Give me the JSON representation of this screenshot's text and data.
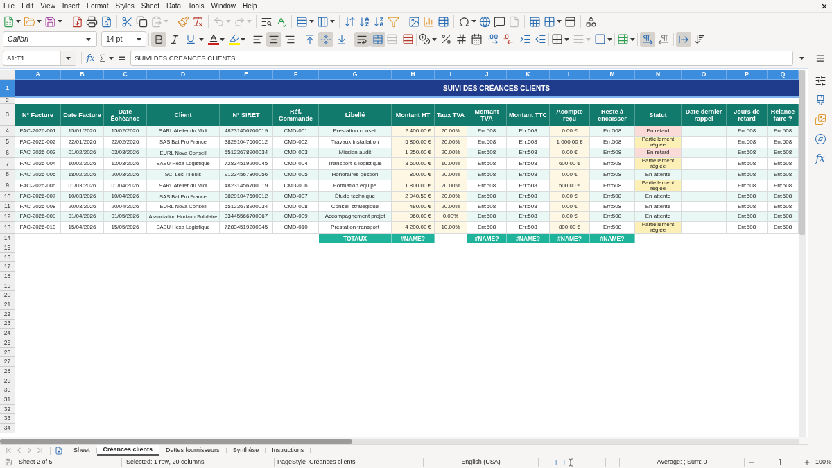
{
  "menu_bar": {
    "items": [
      "File",
      "Edit",
      "View",
      "Insert",
      "Format",
      "Styles",
      "Sheet",
      "Data",
      "Tools",
      "Window",
      "Help"
    ]
  },
  "standard_toolbar": {
    "paste": {
      "disabled": true
    },
    "undo": {
      "disabled": true
    },
    "redo": {
      "disabled": true
    },
    "header_footer": {
      "disabled": true
    }
  },
  "formatting_toolbar": {
    "font_name": "Calibri",
    "font_size": "14 pt",
    "bold": {
      "pressed": true
    },
    "italic": {
      "pressed": false
    },
    "underline": {
      "pressed": false
    },
    "align_left": {
      "pressed": false
    },
    "align_center": {
      "pressed": true
    },
    "align_right": {
      "pressed": false
    },
    "align_top": {
      "pressed": false
    },
    "align_middle": {
      "pressed": true
    },
    "align_bottom": {
      "pressed": false
    },
    "wrap_text": {
      "pressed": true
    },
    "merge_cells": {
      "pressed": true
    },
    "unmerge_cells": {
      "disabled": true
    },
    "border_style": {
      "disabled": true
    },
    "left_to_right": {
      "pressed": true
    },
    "right_to_left": {
      "pressed": false
    },
    "text_horizontal": {
      "pressed": true
    },
    "text_vertical": {
      "pressed": false
    }
  },
  "formula_bar": {
    "name_box": "A1:T1",
    "function_wizard": "fx",
    "formula": "SUIVI DES CRÉANCES CLIENTS"
  },
  "sheet": {
    "column_headers": [
      {
        "label": "A",
        "selected": true
      },
      {
        "label": "B",
        "selected": true
      },
      {
        "label": "C",
        "selected": true
      },
      {
        "label": "D",
        "selected": true
      },
      {
        "label": "E",
        "selected": true
      },
      {
        "label": "F",
        "selected": true
      },
      {
        "label": "G",
        "selected": true
      },
      {
        "label": "H",
        "selected": true
      },
      {
        "label": "I",
        "selected": true
      },
      {
        "label": "J",
        "selected": true
      },
      {
        "label": "K",
        "selected": true
      },
      {
        "label": "L",
        "selected": true
      },
      {
        "label": "M",
        "selected": true
      },
      {
        "label": "N",
        "selected": true
      },
      {
        "label": "O",
        "selected": true
      },
      {
        "label": "P",
        "selected": true
      },
      {
        "label": "Q",
        "selected": true
      }
    ],
    "row_headers": [
      {
        "label": "1",
        "selected": true
      },
      {
        "label": "2",
        "selected": false
      },
      {
        "label": "3",
        "selected": false
      },
      {
        "label": "4",
        "selected": false
      },
      {
        "label": "5",
        "selected": false
      },
      {
        "label": "6",
        "selected": false
      },
      {
        "label": "7",
        "selected": false
      },
      {
        "label": "8",
        "selected": false
      },
      {
        "label": "9",
        "selected": false
      },
      {
        "label": "10",
        "selected": false
      },
      {
        "label": "11",
        "selected": false
      },
      {
        "label": "12",
        "selected": false
      },
      {
        "label": "13",
        "selected": false
      },
      {
        "label": "14",
        "selected": false
      },
      {
        "label": "15",
        "selected": false
      },
      {
        "label": "16",
        "selected": false
      },
      {
        "label": "17",
        "selected": false
      },
      {
        "label": "18",
        "selected": false
      },
      {
        "label": "19",
        "selected": false
      },
      {
        "label": "20",
        "selected": false
      },
      {
        "label": "21",
        "selected": false
      },
      {
        "label": "22",
        "selected": false
      },
      {
        "label": "23",
        "selected": false
      },
      {
        "label": "24",
        "selected": false
      },
      {
        "label": "25",
        "selected": false
      },
      {
        "label": "26",
        "selected": false
      },
      {
        "label": "27",
        "selected": false
      },
      {
        "label": "28",
        "selected": false
      },
      {
        "label": "29",
        "selected": false
      },
      {
        "label": "30",
        "selected": false
      },
      {
        "label": "31",
        "selected": false
      },
      {
        "label": "32",
        "selected": false
      },
      {
        "label": "33",
        "selected": false
      },
      {
        "label": "34",
        "selected": false
      }
    ],
    "title": "SUIVI DES CRÉANCES CLIENTS",
    "header_row": [
      "N° Facture",
      "Date Facture",
      "Date Échéance",
      "Client",
      "N° SIRET",
      "Réf. Commande",
      "Libellé",
      "Montant HT",
      "Taux TVA",
      "Montant TVA",
      "Montant TTC",
      "Acompte reçu",
      "Reste à encaisser",
      "Statut",
      "Date dernier rappel",
      "Jours de retard",
      "Relance faire ?"
    ],
    "rows": [
      {
        "invoice": "FAC-2026-001",
        "date": "15/01/2026",
        "due": "15/02/2026",
        "client": "SARL Atelier du Midi",
        "siret": "48231456700019",
        "order_ref": "CMD-001",
        "label": "Prestation conseil",
        "amount_ht": "2 400.00 €",
        "vat_rate": "20.00%",
        "vat": "Err:508",
        "ttc": "Err:508",
        "deposit": "0.00 €",
        "remaining": "Err:508",
        "status": {
          "text": "En retard",
          "color": "#fadbd8"
        },
        "days_late": "Err:508",
        "reminder": "Err:508"
      },
      {
        "invoice": "FAC-2026-002",
        "date": "22/01/2026",
        "due": "22/02/2026",
        "client": "SAS BatiPro France",
        "siret": "38291047600012",
        "order_ref": "CMD-002",
        "label": "Travaux installation",
        "amount_ht": "5 800.00 €",
        "vat_rate": "20.00%",
        "vat": "Err:508",
        "ttc": "Err:508",
        "deposit": "1 000.00 €",
        "remaining": "Err:508",
        "status": {
          "text": "Partiellement réglée",
          "color": "#fcf0b6"
        },
        "days_late": "Err:508",
        "reminder": "Err:508"
      },
      {
        "invoice": "FAC-2026-003",
        "date": "01/02/2026",
        "due": "03/03/2026",
        "client": "EURL Nova Conseil",
        "siret": "55123678900034",
        "order_ref": "CMD-003",
        "label": "Mission audit",
        "amount_ht": "1 250.00 €",
        "vat_rate": "20.00%",
        "vat": "Err:508",
        "ttc": "Err:508",
        "deposit": "0.00 €",
        "remaining": "Err:508",
        "status": {
          "text": "En retard",
          "color": "#fadbd8"
        },
        "days_late": "Err:508",
        "reminder": "Err:508"
      },
      {
        "invoice": "FAC-2026-004",
        "date": "10/02/2026",
        "due": "12/03/2026",
        "client": "SASU Hexa Logistique",
        "siret": "72834519200045",
        "order_ref": "CMD-004",
        "label": "Transport & logistique",
        "amount_ht": "3 600.00 €",
        "vat_rate": "10.00%",
        "vat": "Err:508",
        "ttc": "Err:508",
        "deposit": "600.00 €",
        "remaining": "Err:508",
        "status": {
          "text": "Partiellement réglée",
          "color": "#fcf0b6"
        },
        "days_late": "Err:508",
        "reminder": "Err:508"
      },
      {
        "invoice": "FAC-2026-005",
        "date": "18/02/2026",
        "due": "20/03/2026",
        "client": "SCI Les Tilleuls",
        "siret": "91234567800056",
        "order_ref": "CMD-005",
        "label": "Honoraires gestion",
        "amount_ht": "800.00 €",
        "vat_rate": "20.00%",
        "vat": "Err:508",
        "ttc": "Err:508",
        "deposit": "0.00 €",
        "remaining": "Err:508",
        "status": {
          "text": "En attente"
        },
        "days_late": "Err:508",
        "reminder": "Err:508"
      },
      {
        "invoice": "FAC-2026-006",
        "date": "01/03/2026",
        "due": "01/04/2026",
        "client": "SARL Atelier du Midi",
        "siret": "48231456700019",
        "order_ref": "CMD-006",
        "label": "Formation équipe",
        "amount_ht": "1 800.00 €",
        "vat_rate": "20.00%",
        "vat": "Err:508",
        "ttc": "Err:508",
        "deposit": "500.00 €",
        "remaining": "Err:508",
        "status": {
          "text": "Partiellement réglée",
          "color": "#fcf0b6"
        },
        "days_late": "Err:508",
        "reminder": "Err:508"
      },
      {
        "invoice": "FAC-2026-007",
        "date": "10/03/2026",
        "due": "10/04/2026",
        "client": "SAS BatiPro France",
        "siret": "38291047600012",
        "order_ref": "CMD-007",
        "label": "Étude technique",
        "amount_ht": "2 940.50 €",
        "vat_rate": "20.00%",
        "vat": "Err:508",
        "ttc": "Err:508",
        "deposit": "0.00 €",
        "remaining": "Err:508",
        "status": {
          "text": "En attente"
        },
        "days_late": "Err:508",
        "reminder": "Err:508"
      },
      {
        "invoice": "FAC-2026-008",
        "date": "20/03/2026",
        "due": "20/04/2026",
        "client": "EURL Nova Conseil",
        "siret": "55123678900034",
        "order_ref": "CMD-008",
        "label": "Conseil stratégique",
        "amount_ht": "480.00 €",
        "vat_rate": "20.00%",
        "vat": "Err:508",
        "ttc": "Err:508",
        "deposit": "0.00 €",
        "remaining": "Err:508",
        "status": {
          "text": "En attente"
        },
        "days_late": "Err:508",
        "reminder": "Err:508"
      },
      {
        "invoice": "FAC-2026-009",
        "date": "01/04/2026",
        "due": "01/05/2026",
        "client": "Association Horizon Solidaire",
        "siret": "33445566700067",
        "order_ref": "CMD-009",
        "label": "Accompagnement projet",
        "amount_ht": "960.00 €",
        "vat_rate": "0.00%",
        "vat": "Err:508",
        "ttc": "Err:508",
        "deposit": "0.00 €",
        "remaining": "Err:508",
        "status": {
          "text": "En attente"
        },
        "days_late": "Err:508",
        "reminder": "Err:508"
      },
      {
        "invoice": "FAC-2026-010",
        "date": "15/04/2026",
        "due": "15/05/2026",
        "client": "SASU Hexa Logistique",
        "siret": "72834519200045",
        "order_ref": "CMD-010",
        "label": "Prestation transport",
        "amount_ht": "4 200.00 €",
        "vat_rate": "10.00%",
        "vat": "Err:508",
        "ttc": "Err:508",
        "deposit": "800.00 €",
        "remaining": "Err:508",
        "status": {
          "text": "Partiellement réglée",
          "color": "#fcf0b6"
        },
        "days_late": "Err:508",
        "reminder": "Err:508"
      }
    ],
    "totals": {
      "label": "TOTAUX",
      "amount_ht": "#NAME?",
      "vat": "#NAME?",
      "ttc": "#NAME?",
      "deposit": "#NAME?",
      "remaining": "#NAME?"
    }
  },
  "sidebar": {
    "functions": "fx"
  },
  "sheet_tabs": [
    {
      "label": "Sheet",
      "selected": false
    },
    {
      "label": "Créances clients",
      "selected": true
    },
    {
      "label": "Dettes fournisseurs",
      "selected": false
    },
    {
      "label": "Synthèse",
      "selected": false
    },
    {
      "label": "Instructions",
      "selected": false
    }
  ],
  "status_bar": {
    "sheet": "Sheet 2 of 5",
    "selection": "Selected: 1 row, 20 columns",
    "page_style": "PageStyle_Créances clients",
    "language": "English (USA)",
    "summary": "Average: ; Sum: 0",
    "zoom": {
      "level": 0.5,
      "reading": "100%"
    }
  }
}
